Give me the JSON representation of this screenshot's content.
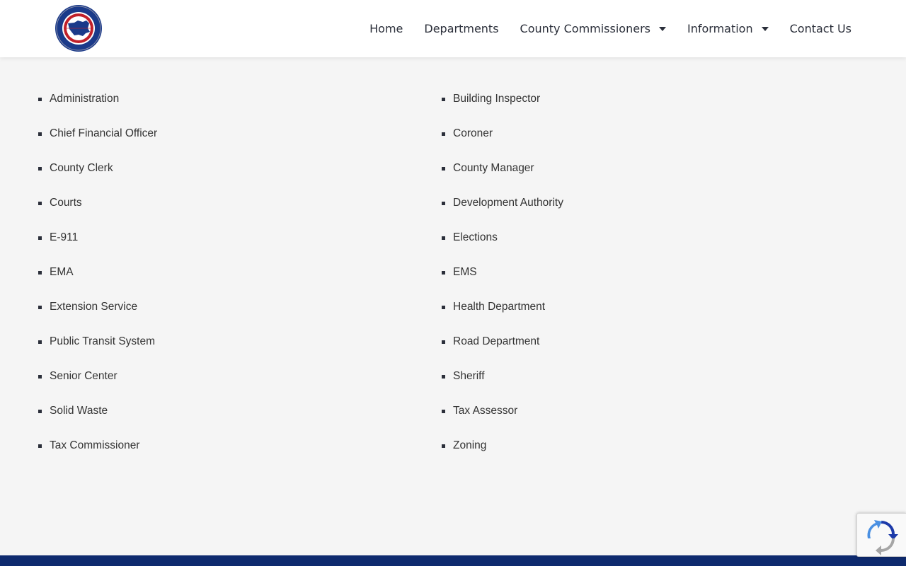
{
  "header": {
    "logo": {
      "icon": "county-seal-logo",
      "ring_text_top": "BEN HILL COUNTY",
      "ring_text_bottom": "GEORGIA"
    },
    "nav": {
      "home": "Home",
      "departments": "Departments",
      "commissioners": "County Commissioners",
      "information": "Information",
      "contact": "Contact Us"
    }
  },
  "departments": {
    "left": [
      "Administration",
      "Chief Financial Officer",
      "County Clerk",
      "Courts",
      "E-911",
      "EMA",
      "Extension Service",
      "Public Transit System",
      "Senior Center",
      "Solid Waste",
      "Tax Commissioner"
    ],
    "right": [
      "Building Inspector",
      "Coroner",
      "County Manager",
      "Development Authority",
      "Elections",
      "EMS",
      "Health Department",
      "Road Department",
      "Sheriff",
      "Tax Assessor",
      "Zoning"
    ]
  },
  "colors": {
    "footer": "#0e2a6e",
    "background": "#f5f5f5",
    "seal_blue": "#1a3a8a",
    "seal_red": "#c0202a"
  },
  "recaptcha": {
    "icon": "recaptcha-icon"
  }
}
